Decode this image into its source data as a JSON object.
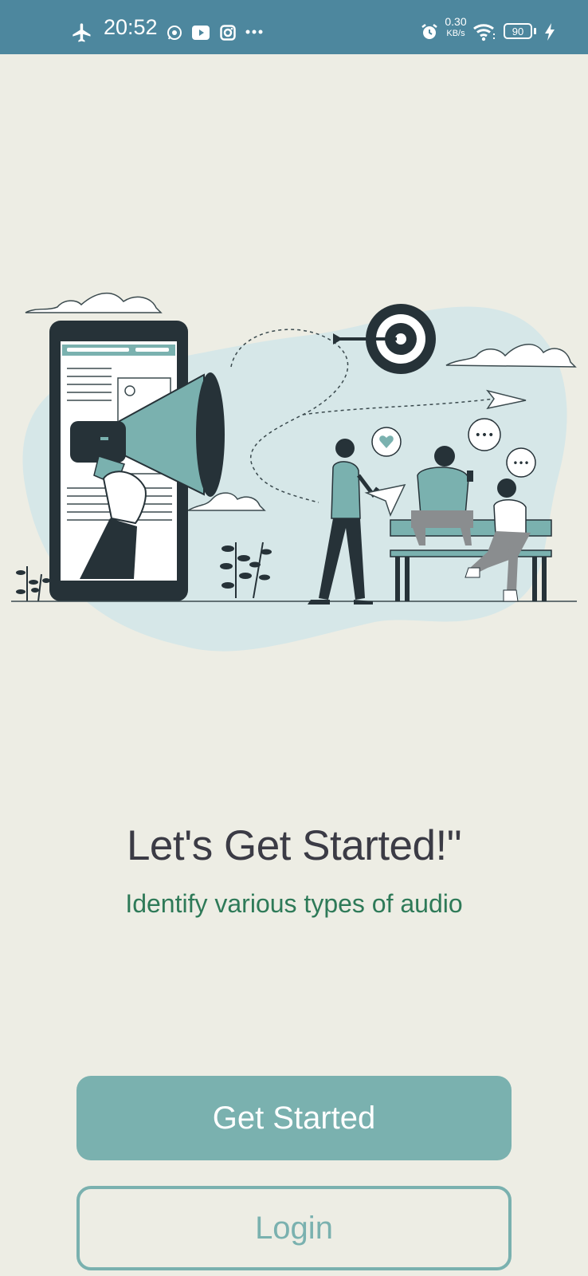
{
  "status_bar": {
    "time": "20:52",
    "network_speed_value": "0.30",
    "network_speed_unit": "KB/s",
    "battery_level": "90",
    "icons": [
      "airplane-icon",
      "whatsapp-icon",
      "youtube-icon",
      "instagram-icon",
      "more-icon",
      "alarm-icon",
      "wifi-icon",
      "battery-icon",
      "charging-icon"
    ],
    "color": "#4d879e"
  },
  "onboarding": {
    "illustration": "megaphone-marketing-illustration",
    "title": "Let's Get Started!\"",
    "subtitle": "Identify various types of audio"
  },
  "actions": {
    "get_started_label": "Get Started",
    "login_label": "Login"
  },
  "colors": {
    "background": "#edede4",
    "accent": "#7ab1af",
    "title": "#3b3b45",
    "subtitle": "#2e7a58"
  }
}
